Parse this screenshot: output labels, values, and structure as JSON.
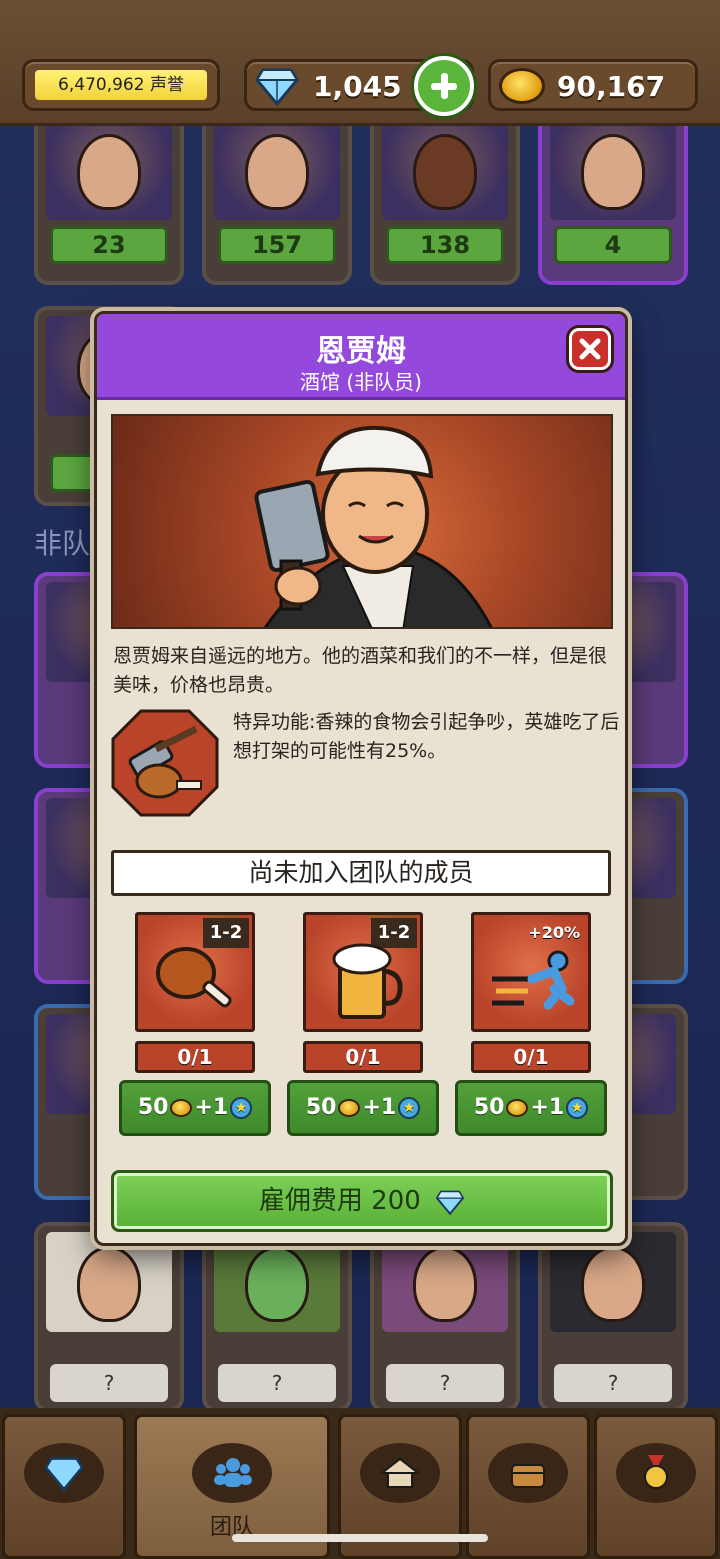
{
  "topbar": {
    "fame_value": "6,470,962 声誉",
    "gems": "1,045",
    "gold": "90,167"
  },
  "roster": {
    "top_stats": [
      "23",
      "157",
      "138",
      "4"
    ],
    "partial_stat": "4",
    "section_label": "非队",
    "unknown_label": "?"
  },
  "modal": {
    "title": "恩贾姆",
    "subtitle": "酒馆 (非队员)",
    "description": "恩贾姆来自遥远的地方。他的酒菜和我们的不一样，但是很美味，价格也昂贵。",
    "ability": "特异功能:香辣的食物会引起争吵，英雄吃了后想打架的可能性有25%。",
    "section_title": "尚未加入团队的成员",
    "bonuses": [
      {
        "icon": "drumstick-icon",
        "tag": "1-2",
        "progress": "0/1",
        "cost_coin": "50",
        "cost_star": "1"
      },
      {
        "icon": "beer-mug-icon",
        "tag": "1-2",
        "progress": "0/1",
        "cost_coin": "50",
        "cost_star": "1"
      },
      {
        "icon": "speed-runner-icon",
        "tag": "+20%",
        "progress": "0/1",
        "cost_coin": "50",
        "cost_star": "1"
      }
    ],
    "hire_label": "雇佣费用 200"
  },
  "nav": {
    "team_label": "团队",
    "tabs": [
      "gem-shop-icon",
      "team-icon",
      "building-icon",
      "treasure-chest-icon",
      "medal-icon"
    ]
  },
  "colors": {
    "header_purple": "#9448dc",
    "button_green": "#58b036",
    "bonus_red": "#b9442a"
  }
}
